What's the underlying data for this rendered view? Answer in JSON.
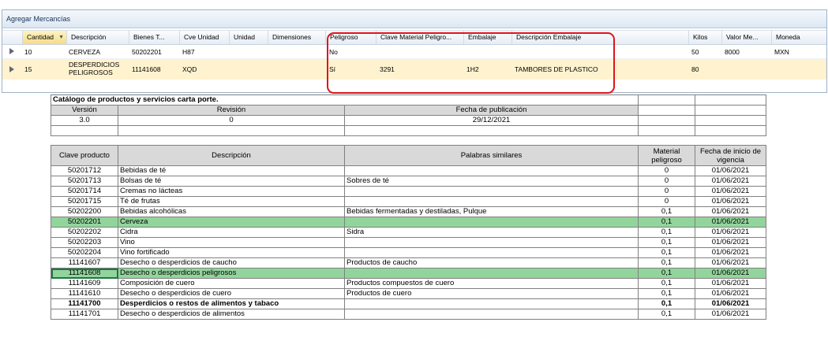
{
  "panel": {
    "title": "Agregar Mercancías",
    "columns": [
      "Cantidad",
      "Descripción",
      "Bienes T...",
      "Cve Unidad",
      "Unidad",
      "Dimensiones",
      "Peligroso",
      "Clave Material Peligro...",
      "Embalaje",
      "Descripción Embalaje",
      "Kilos",
      "Valor Me...",
      "Moneda"
    ],
    "sort_icon": "sort-dropdown-icon",
    "rows": [
      {
        "cantidad": "10",
        "descripcion": "CERVEZA",
        "bienes": "50202201",
        "cve_unidad": "H87",
        "unidad": "",
        "dimensiones": "",
        "peligroso": "No",
        "clave_material": "",
        "embalaje": "",
        "desc_embalaje": "",
        "kilos": "50",
        "valor": "8000",
        "moneda": "MXN"
      },
      {
        "cantidad": "15",
        "descripcion": "DESPERDICIOS PELIGROSOS",
        "descripcion_l1": "DESPERDICIOS",
        "descripcion_l2": "PELIGROSOS",
        "bienes": "11141608",
        "cve_unidad": "XQD",
        "unidad": "",
        "dimensiones": "",
        "peligroso": "Sí",
        "clave_material": "3291",
        "embalaje": "1H2",
        "desc_embalaje": "TAMBORES DE PLASTICO",
        "kilos": "80",
        "valor": "",
        "moneda": ""
      }
    ]
  },
  "catalog": {
    "title": "Catálogo de productos y servicios carta porte.",
    "meta_headers": [
      "Versión",
      "Revisión",
      "Fecha de publicación"
    ],
    "meta_values": [
      "3.0",
      "0",
      "29/12/2021"
    ],
    "headers": [
      "Clave producto",
      "Descripción",
      "Palabras similares",
      "Material peligroso",
      "Fecha de inicio de vigencia"
    ],
    "headers_split": {
      "material_l1": "Material",
      "material_l2": "peligroso",
      "fecha_l1": "Fecha de inicio de",
      "fecha_l2": "vigencia"
    },
    "rows": [
      [
        "50201712",
        "Bebidas de té",
        "",
        "0",
        "01/06/2021"
      ],
      [
        "50201713",
        "Bolsas de té",
        "Sobres de té",
        "0",
        "01/06/2021"
      ],
      [
        "50201714",
        "Cremas no lácteas",
        "",
        "0",
        "01/06/2021"
      ],
      [
        "50201715",
        "Té de frutas",
        "",
        "0",
        "01/06/2021"
      ],
      [
        "50202200",
        "Bebidas alcohólicas",
        "Bebidas fermentadas y destiladas, Pulque",
        "0,1",
        "01/06/2021"
      ],
      [
        "50202201",
        "Cerveza",
        "",
        "0,1",
        "01/06/2021"
      ],
      [
        "50202202",
        "Cidra",
        "Sidra",
        "0,1",
        "01/06/2021"
      ],
      [
        "50202203",
        "Vino",
        "",
        "0,1",
        "01/06/2021"
      ],
      [
        "50202204",
        "Vino fortificado",
        "",
        "0,1",
        "01/06/2021"
      ],
      [
        "11141607",
        "Desecho o desperdicios de caucho",
        "Productos de caucho",
        "0,1",
        "01/06/2021"
      ],
      [
        "11141608",
        "Desecho o desperdicios peligrosos",
        "",
        "0,1",
        "01/06/2021"
      ],
      [
        "11141609",
        "Composición de cuero",
        "Productos compuestos de cuero",
        "0,1",
        "01/06/2021"
      ],
      [
        "11141610",
        "Desecho o desperdicios de cuero",
        "Productos de cuero",
        "0,1",
        "01/06/2021"
      ],
      [
        "11141700",
        "Desperdicios o restos de alimentos y tabaco",
        "",
        "0,1",
        "01/06/2021"
      ],
      [
        "11141701",
        "Desecho o desperdicios de alimentos",
        "",
        "0,1",
        "01/06/2021"
      ]
    ],
    "green_rows": [
      5,
      10
    ],
    "bold_rows": [
      13
    ],
    "highlight_color": "#92d59c",
    "callout_color": "#e0141c"
  }
}
